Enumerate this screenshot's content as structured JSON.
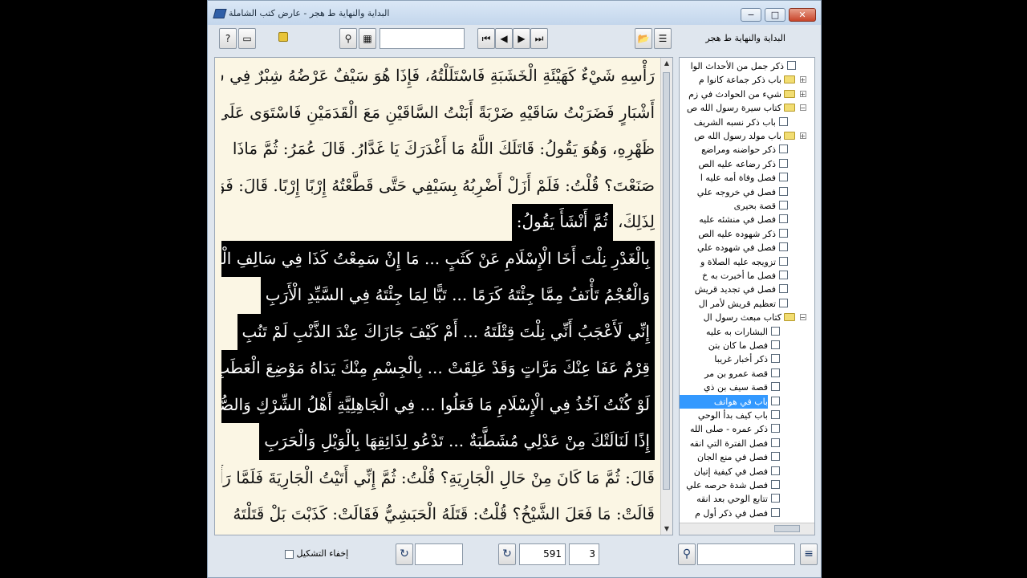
{
  "window": {
    "title": "البداية والنهاية ط هجر - عارض كتب الشاملة",
    "minimize": "−",
    "maximize": "□",
    "close": "✕"
  },
  "toolbar": {
    "help": "?",
    "page": "▭",
    "lock": "🔒",
    "search": "⚲",
    "find_page": "▦",
    "first": "⏮",
    "prev": "◀",
    "next": "▶",
    "last": "⏭",
    "folder_open": "📂",
    "toc": "☰",
    "search_value": "",
    "book_title": "البداية والنهاية ط هجر"
  },
  "reader": {
    "lines": [
      "رَأْسِهِ شَيْءٌ كَهَيْئَةِ الْخَشَبَةِ فَاسْتَلَلْتُهُ، فَإِذَا هُوَ سَيْفٌ عَرْضُهُ شِبْرٌ فِي سَبْعَةِ",
      "أَشْبَارٍ فَضَرَبْتُ سَاقَيْهِ ضَرْبَةً أَبَنْتُ السَّاقَيْنِ مَعَ الْقَدَمَيْنِ فَاسْتَوَى عَلَى فَقَارِ",
      "ظَهْرِهِ، وَهُوَ يَقُولُ: قَاتَلَكَ اللَّهُ مَا أَغْدَرَكَ يَا غَدَّارُ. قَالَ عُمَرُ: ثُمَّ مَاذَا",
      "صَنَعْتَ؟ قُلْتُ: فَلَمْ أَزَلْ أَضْرِبُهُ بِسَيْفِي حَتَّى قَطَّعْتُهُ إِرْبًا إِرْبًا. قَالَ: فَوَجَمَ",
      "لِذَلِكَ، ثُمَّ أَنْشَأَ يَقُولُ:",
      "بِالْغَدْرِ نِلْتَ أَخَا الْإِسْلَامِ عَنْ كَثَبٍ ... مَا إِنْ سَمِعْتُ كَذَا فِي سَالِفِ الْعَرَبِ",
      "وَالْعُجْمُ تَأْنَفُ مِمَّا جِئْتَهُ كَرَمًا ... تَبًّا لِمَا جِئْتَهُ فِي السَّيِّدِ الْأَرَبِ",
      "إِنِّي لَأَعْجَبُ أَنِّي نِلْتَ قِتْلَتَهُ ... أَمْ كَيْفَ جَازَاكَ عِنْدَ الذَّنْبِ لَمْ تَنُبِ",
      "قِرْمٌ عَفَا عِنْكَ مَرَّاتٍ وَقَدْ عَلِقَتْ ... بِالْجِسْمِ مِنْكَ يَدَاهُ مَوْضِعَ الْعَطَبِ",
      "لَوْ كُنْتُ آخُذُ فِي الْإِسْلَامِ مَا فَعَلُوا ... فِي الْجَاهِلِيَّةِ أَهْلُ الشِّرْكِ وَالصُّلُبِ",
      "إِذًا لَنَالَتْكَ مِنْ عَدْلِي مُشَطَّبَةٌ ... تَدْعُو لِذَائِقِهَا بِالْوَيْلِ وَالْحَرَبِ",
      "قَالَ: ثُمَّ مَا كَانَ مِنْ حَالِ الْجَارِيَةِ؟ قُلْتُ: ثُمَّ إِنِّي أَتَيْتُ الْجَارِيَةَ فَلَمَّا رَأَتْنِي",
      "قَالَتْ: مَا فَعَلَ الشَّيْخُ؟ قُلْتُ: قَتَلَهُ الْحَبَشِيُّ فَقَالَتْ: كَذَبْتَ بَلْ قَتَلْتَهُ"
    ],
    "highlight_poem_label": "ثُمَّ أَنْشَأَ يَقُولُ:"
  },
  "tree": {
    "items": [
      {
        "label": "ذكر جمل من الأحداث الوا",
        "icon": "checkbox"
      },
      {
        "label": "باب ذكر جماعة كانوا م",
        "icon": "folder",
        "exp": "+"
      },
      {
        "label": "شيء من الحوادث في زم",
        "icon": "folder",
        "exp": "+"
      },
      {
        "label": "كتاب سيرة رسول الله ص",
        "icon": "folder-open",
        "exp": "−"
      },
      {
        "label": "باب ذكر نسبه الشريف",
        "icon": "checkbox"
      },
      {
        "label": "باب مولد رسول الله ص",
        "icon": "folder",
        "exp": "+"
      },
      {
        "label": "ذكر حواضنه ومراضع",
        "icon": "checkbox"
      },
      {
        "label": "ذكر رضاعه عليه الص",
        "icon": "checkbox"
      },
      {
        "label": "فصل وفاة أمه عليه ا",
        "icon": "checkbox"
      },
      {
        "label": "فصل في خروجه علي",
        "icon": "checkbox"
      },
      {
        "label": "قصة بحيرى",
        "icon": "checkbox"
      },
      {
        "label": "فصل في منشئه عليه",
        "icon": "checkbox"
      },
      {
        "label": "ذكر شهوده عليه الص",
        "icon": "checkbox"
      },
      {
        "label": "فصل في شهوده علي",
        "icon": "checkbox"
      },
      {
        "label": "تزويجه عليه الصلاة و",
        "icon": "checkbox"
      },
      {
        "label": "فصل ما أخبرت به خ",
        "icon": "checkbox"
      },
      {
        "label": "فصل في تجديد قريش",
        "icon": "checkbox"
      },
      {
        "label": "تعظيم قريش لأمر ال",
        "icon": "checkbox"
      },
      {
        "label": "كتاب مبعث رسول ال",
        "icon": "folder-open",
        "exp": "−"
      },
      {
        "label": "البشارات به عليه",
        "icon": "checkbox"
      },
      {
        "label": "فصل ما كان بتن",
        "icon": "checkbox"
      },
      {
        "label": "ذكر أخبار غريبا",
        "icon": "checkbox"
      },
      {
        "label": "قصة عمرو بن مر",
        "icon": "checkbox"
      },
      {
        "label": "قصة سيف بن ذي",
        "icon": "checkbox"
      },
      {
        "label": "باب في هواتف",
        "icon": "checkbox",
        "selected": true
      },
      {
        "label": "باب كيف بدأ الوحي",
        "icon": "checkbox"
      },
      {
        "label": "ذكر عمره - صلى الله",
        "icon": "checkbox"
      },
      {
        "label": "فصل الفترة التي انقه",
        "icon": "checkbox"
      },
      {
        "label": "فصل في منع الجان",
        "icon": "checkbox"
      },
      {
        "label": "فصل في كيفية إتيان",
        "icon": "checkbox"
      },
      {
        "label": "فصل شدة حرصه علي",
        "icon": "checkbox"
      },
      {
        "label": "تتابع الوحي بعد انقه",
        "icon": "checkbox"
      },
      {
        "label": "فصل في ذكر أول م",
        "icon": "checkbox"
      }
    ]
  },
  "status": {
    "hide_diacritics_label": "إخفاء التشكيل",
    "refresh_a": "↻",
    "refresh_b": "↻",
    "page_number": "591",
    "part_number": "3",
    "binoculars": "⚲",
    "menu": "≡",
    "search_value": ""
  }
}
